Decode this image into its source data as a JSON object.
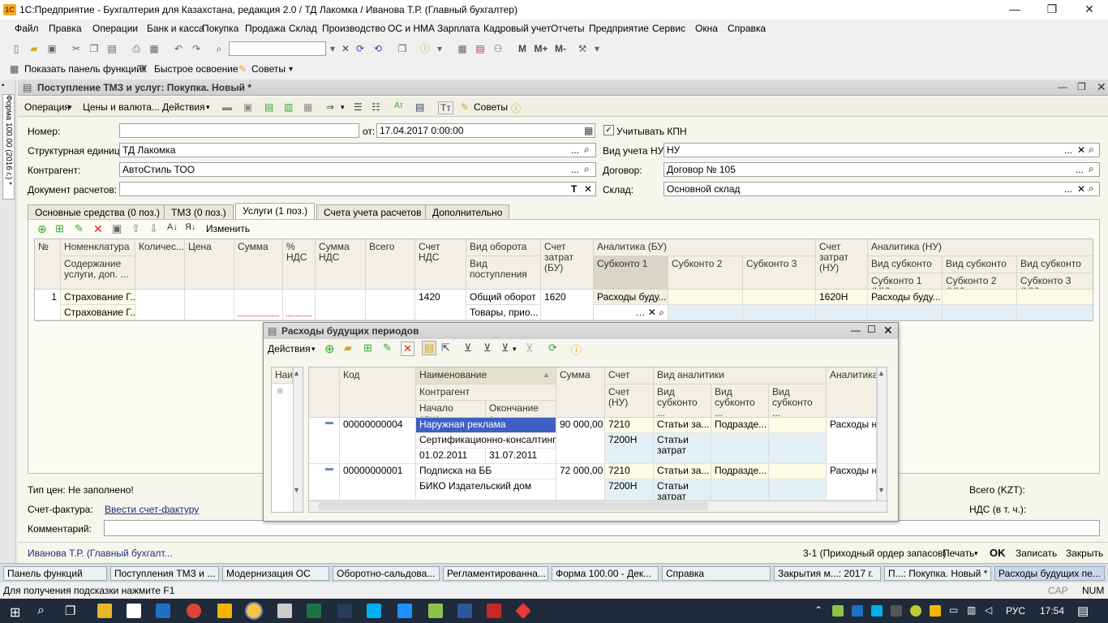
{
  "window": {
    "title": "1С:Предприятие - Бухгалтерия для Казахстана, редакция 2.0 / ТД Лакомка / Иванова Т.Р. (Главный бухгалтер)",
    "min": "—",
    "max": "❐",
    "close": "✕"
  },
  "menu": [
    "Файл",
    "Правка",
    "Операции",
    "Банк и касса",
    "Покупка",
    "Продажа",
    "Склад",
    "Производство",
    "ОС и НМА",
    "Зарплата",
    "Кадровый учет",
    "Отчеты",
    "Предприятие",
    "Сервис",
    "Окна",
    "Справка"
  ],
  "toolbar2": {
    "show_panel": "Показать панель функций",
    "quick": "Быстрое освоение",
    "tips": "Советы"
  },
  "toolbar_icons": {
    "m": "M",
    "mplus": "M+",
    "mminus": "M-"
  },
  "side_tab": "Форма 100.00 (2016 г.) *",
  "doc": {
    "title": "Поступление ТМЗ и услуг: Покупка. Новый *",
    "toolbar": {
      "operation": "Операция",
      "prices": "Цены и валюта...",
      "actions": "Действия",
      "tips": "Советы"
    },
    "fields": {
      "number_label": "Номер:",
      "number": "",
      "from_label": "от:",
      "date": "17.04.2017  0:00:00",
      "kpn_label": "Учитывать КПН",
      "unit_label": "Структурная единица:",
      "unit": "ТД Лакомка",
      "nu_label": "Вид учета НУ:",
      "nu": "НУ",
      "contractor_label": "Контрагент:",
      "contractor": "АвтоСтиль ТОО",
      "contract_label": "Договор:",
      "contract": "Договор № 105",
      "docsettle_label": "Документ расчетов:",
      "docsettle": "",
      "warehouse_label": "Склад:",
      "warehouse": "Основной склад"
    },
    "tabs": [
      "Основные средства (0 поз.)",
      "ТМЗ (0 поз.)",
      "Услуги (1 поз.)",
      "Счета учета расчетов",
      "Дополнительно"
    ],
    "grid_tb": {
      "change": "Изменить"
    },
    "grid_headers": {
      "n": "№",
      "nom": "Номенклатура",
      "content": "Содержание услуги, доп. ...",
      "qty": "Количес...",
      "price": "Цена",
      "sum": "Сумма",
      "vat_pct": "% НДС",
      "vat_sum": "Сумма НДС",
      "total": "Всего",
      "vat_acc": "Счет НДС",
      "turnover": "Вид оборота",
      "receipt": "Вид поступления",
      "cost_acc": "Счет затрат (БУ)",
      "analytics": "Аналитика (БУ)",
      "sub1": "Субконто 1",
      "sub2": "Субконто 2",
      "sub3": "Субконто 3",
      "cost_acc_nu": "Счет затрат (НУ)",
      "analytics_nu": "Аналитика (НУ)",
      "vs1": "Вид субконто ...",
      "vs2": "Вид субконто ...",
      "vs3": "Вид субконто ...",
      "s1nu": "Субконто 1 (НУ)",
      "s2nu": "Субконто 2 (НУ)",
      "s3nu": "Субконто 3 (НУ)"
    },
    "row": {
      "n": "1",
      "nom": "Страхование Г...",
      "content": "Страхование Г...",
      "vat_acc": "1420",
      "turnover": "Общий оборот",
      "receipt": "Товары, прио...",
      "cost_acc": "1620",
      "sub1": "Расходы буду...",
      "cost_acc_nu": "1620Н",
      "vs1": "Расходы буду..."
    },
    "price_type": "Тип цен: Не заполнено!",
    "invoice_label": "Счет-фактура:",
    "invoice_link": "Ввести счет-фактуру",
    "comment_label": "Комментарий:",
    "total_label": "Всего (KZT):",
    "vat_label": "НДС (в т. ч.):",
    "author": "Иванова Т.Р. (Главный бухгалт...",
    "print_form": "3-1 (Приходный ордер запасов)",
    "print": "Печать",
    "ok": "OK",
    "save": "Записать",
    "close": "Закрыть"
  },
  "popup": {
    "title": "Расходы будущих периодов",
    "actions": "Действия",
    "left_header": "Наи",
    "headers": {
      "code": "Код",
      "name": "Наименование",
      "contractor": "Контрагент",
      "start": "Начало спис...",
      "end": "Окончание с...",
      "sum": "Сумма",
      "acc": "Счет",
      "acc_nu": "Счет (НУ)",
      "va": "Вид аналитики",
      "vs1": "Вид субконто ...",
      "vs2": "Вид субконто ...",
      "vs3": "Вид субконто ...",
      "analytics": "Аналитика"
    },
    "rows": [
      {
        "code": "00000000004",
        "name": "Наружная реклама",
        "contractor": "Сертификационно-консалтинг...",
        "start": "01.02.2011",
        "end": "31.07.2011",
        "sum": "90 000,00",
        "acc": "7210",
        "acc_nu": "7200Н",
        "vs1": "Статьи за...",
        "vs1b": "Статьи затрат",
        "vs2": "Подразде...",
        "an": "Расходы на"
      },
      {
        "code": "00000000001",
        "name": "Подписка на ББ",
        "contractor": "БИКО Издательский дом",
        "sum": "72 000,00",
        "acc": "7210",
        "acc_nu": "7200Н",
        "vs1": "Статьи за...",
        "vs1b": "Статьи затрат",
        "vs2": "Подразде...",
        "an": "Расходы на"
      }
    ]
  },
  "taskbar_windows": [
    "Панель функций",
    "Поступления ТМЗ и ...",
    "Модернизация ОС",
    "Оборотно-сальдова...",
    "Регламентированна...",
    "Форма 100.00 - Дек...",
    "Справка",
    "Закрытия м...: 2017 г.",
    "П...: Покупка. Новый *",
    "Расходы будущих пе..."
  ],
  "hint": "Для получения подсказки нажмите F1",
  "cap": "CAP",
  "num": "NUM",
  "tray": {
    "lang": "РУС",
    "time": "17:54"
  }
}
